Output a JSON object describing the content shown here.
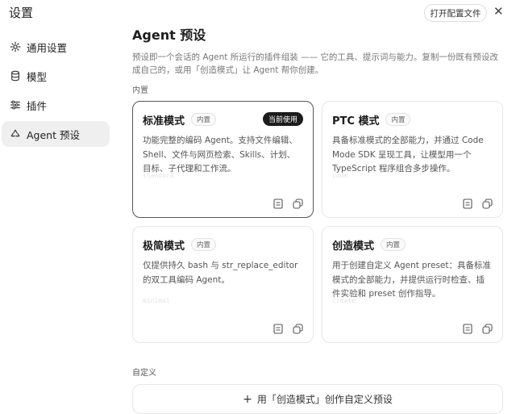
{
  "window": {
    "title": "设置",
    "open_config_label": "打开配置文件",
    "close_icon": "close-icon"
  },
  "sidebar": {
    "items": [
      {
        "label": "通用设置",
        "icon": "gear-icon",
        "active": false
      },
      {
        "label": "模型",
        "icon": "database-icon",
        "active": false
      },
      {
        "label": "插件",
        "icon": "sliders-icon",
        "active": false
      },
      {
        "label": "Agent 预设",
        "icon": "recycle-icon",
        "active": true
      }
    ]
  },
  "main": {
    "title": "Agent 预设",
    "description": "预设即一个会话的 Agent 所运行的插件组装 —— 它的工具、提示词与能力。复制一份既有预设改成自己的，或用「创造模式」让 Agent 帮你创建。",
    "builtin_section": "内置",
    "custom_section": "自定义",
    "create_label": "用「创造模式」创作自定义预设",
    "cards": [
      {
        "title": "标准模式",
        "badge": "内置",
        "current": "当前使用",
        "desc": "功能完整的编码 Agent。支持文件编辑、Shell、文件与网页检索、Skills、计划、目标、子代理和工作流。",
        "slug": "standard",
        "selected": true
      },
      {
        "title": "PTC 模式",
        "badge": "内置",
        "current": "",
        "desc": "具备标准模式的全部能力，并通过 Code Mode SDK 呈现工具，让模型用一个 TypeScript 程序组合多步操作。",
        "slug": "code",
        "selected": false
      },
      {
        "title": "极简模式",
        "badge": "内置",
        "current": "",
        "desc": "仅提供持久 bash 与 str_replace_editor 的双工具编码 Agent。",
        "slug": "minimal",
        "selected": false
      },
      {
        "title": "创造模式",
        "badge": "内置",
        "current": "",
        "desc": "用于创建自定义 Agent preset：具备标准模式的全部能力，并提供运行时检查、插件实验和 preset 创作指导。",
        "slug": "create",
        "selected": false
      }
    ]
  }
}
